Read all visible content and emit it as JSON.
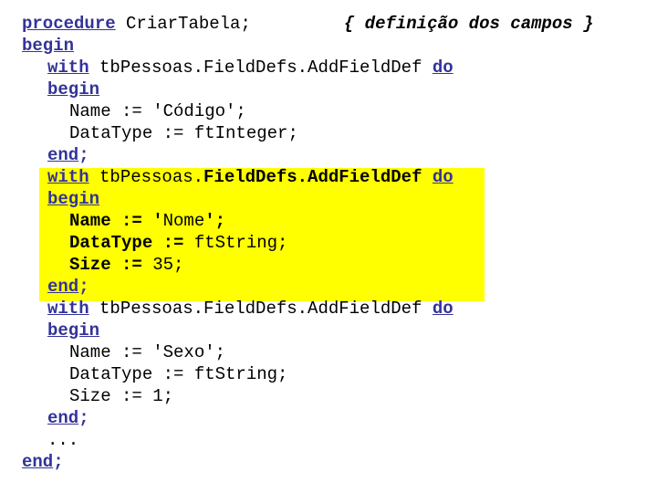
{
  "slide": {
    "language": "pascal",
    "background_color": "#ffffff",
    "keyword_color": "#333399",
    "text_color": "#000000",
    "highlight_color": "#ffff00",
    "highlight_note": "second with-block (Nome field) is highlighted in yellow"
  },
  "code": {
    "line_01": {
      "keyword": "procedure",
      "name": " CriarTabela;",
      "comment": "{ definição dos campos }"
    },
    "line_02": {
      "keyword": "begin"
    },
    "line_03": {
      "keyword": "with",
      "expr": " tbPessoas.FieldDefs.AddFieldDef ",
      "keyword2": "do"
    },
    "line_04": {
      "keyword": "begin"
    },
    "line_05": {
      "text": "Name := 'Código';"
    },
    "line_06": {
      "text": "DataType := ftInteger;"
    },
    "line_07": {
      "keyword": "end",
      "punct": ";"
    },
    "line_08": {
      "keyword": "with",
      "expr_plain": " tbPessoas.",
      "expr_bold": "FieldDefs.AddFieldDef",
      "space": " ",
      "keyword2": "do"
    },
    "line_09": {
      "keyword": "begin"
    },
    "line_10": {
      "bold_prefix": "Name := '",
      "plain_value": "Nome",
      "bold_suffix": "';"
    },
    "line_11": {
      "bold_prefix": "DataType := ",
      "plain_value": "ftString;"
    },
    "line_12": {
      "bold_prefix": "Size := ",
      "plain_value": "35;"
    },
    "line_13": {
      "keyword": "end",
      "punct": ";"
    },
    "line_14": {
      "keyword": "with",
      "expr": " tbPessoas.FieldDefs.AddFieldDef ",
      "keyword2": "do"
    },
    "line_15": {
      "keyword": "begin"
    },
    "line_16": {
      "text": "Name := 'Sexo';"
    },
    "line_17": {
      "text": "DataType := ftString;"
    },
    "line_18": {
      "text": "Size := 1;"
    },
    "line_19": {
      "keyword": "end",
      "punct": ";"
    },
    "line_20": {
      "text": "..."
    },
    "line_21": {
      "keyword": "end",
      "punct": ";"
    }
  }
}
